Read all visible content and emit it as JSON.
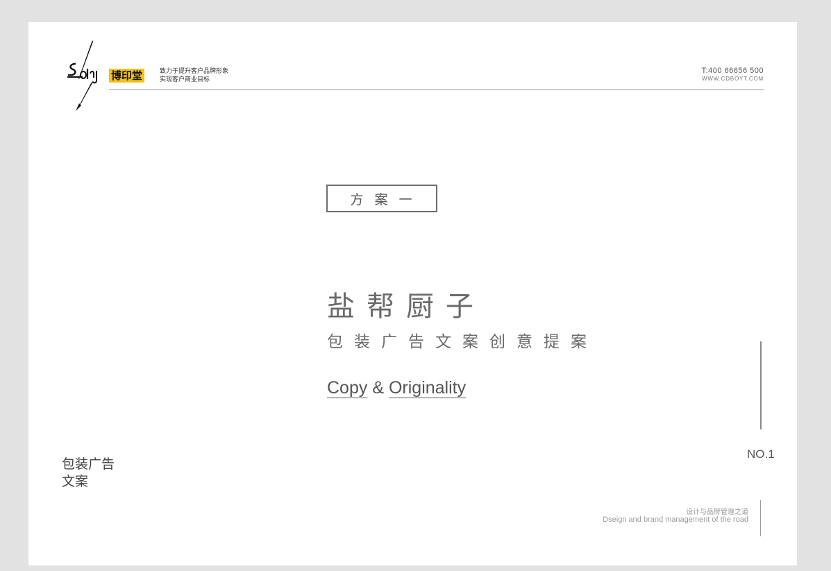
{
  "header": {
    "brand_name": "博印堂",
    "slogan_line1": "致力于提升客户品牌形象",
    "slogan_line2": "实现客户商业目标",
    "phone": "T:400 66656 500",
    "website": "WWW.CDBOYT.COM"
  },
  "main": {
    "plan_label": "方案一",
    "title": "盐帮厨子",
    "subtitle": "包装广告文案创意提案",
    "copy_word": "Copy",
    "amp": "&",
    "originality_word": "Originality",
    "page_number": "NO.1"
  },
  "footer": {
    "side_caption_line1": "包装广告",
    "side_caption_line2": "文案",
    "motto_cn": "设计与品牌管理之道",
    "motto_en": "Dseign and brand management of the road"
  },
  "colors": {
    "accent": "#f2c21a",
    "text_gray": "#6b6b6b",
    "background": "#e2e2e2"
  }
}
